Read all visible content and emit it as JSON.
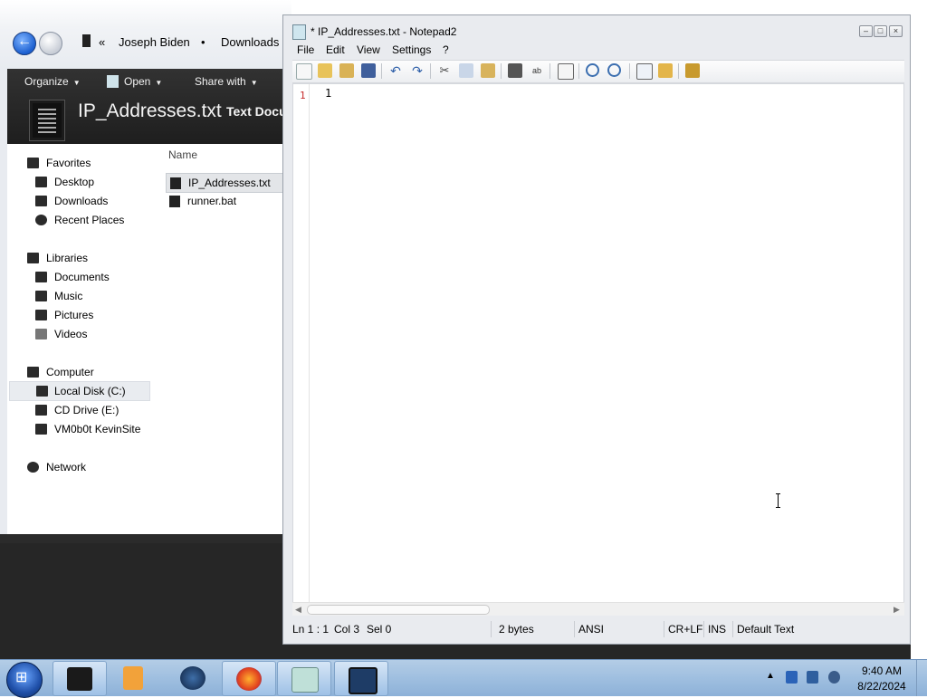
{
  "explorer": {
    "breadcrumb": [
      "«",
      "Joseph Biden",
      "•",
      "Downloads"
    ],
    "toolbar": {
      "organize": "Organize",
      "open": "Open",
      "share_with": "Share with"
    },
    "details": {
      "filename": "IP_Addresses.txt",
      "type": "Text Docu"
    },
    "nav": {
      "favorites": "Favorites",
      "desktop": "Desktop",
      "downloads": "Downloads",
      "recent_places": "Recent Places",
      "libraries": "Libraries",
      "documents": "Documents",
      "music": "Music",
      "pictures": "Pictures",
      "videos": "Videos",
      "computer": "Computer",
      "local_disk": "Local Disk (C:)",
      "cd_drive": "CD Drive (E:)",
      "vm_site": "VM0b0t KevinSite",
      "network": "Network"
    },
    "column_header": "Name",
    "files": [
      "IP_Addresses.txt",
      "runner.bat"
    ]
  },
  "notepad": {
    "title": "* IP_Addresses.txt - Notepad2",
    "menu": [
      "File",
      "Edit",
      "View",
      "Settings",
      "?"
    ],
    "line_number": "1",
    "content": "1",
    "status": {
      "position": "Ln 1 : 1",
      "col": "Col 3",
      "sel": "Sel 0",
      "size": "2 bytes",
      "encoding": "ANSI",
      "eol": "CR+LF",
      "mode": "INS",
      "scheme": "Default Text"
    }
  },
  "taskbar": {
    "time": "9:40 AM",
    "date": "8/22/2024",
    "tray_chevron": "▲"
  },
  "colors": {
    "taskbar": "#9fbfe0",
    "explorer_toolbar": "#2a2a2a",
    "line_number": "#c62828"
  }
}
